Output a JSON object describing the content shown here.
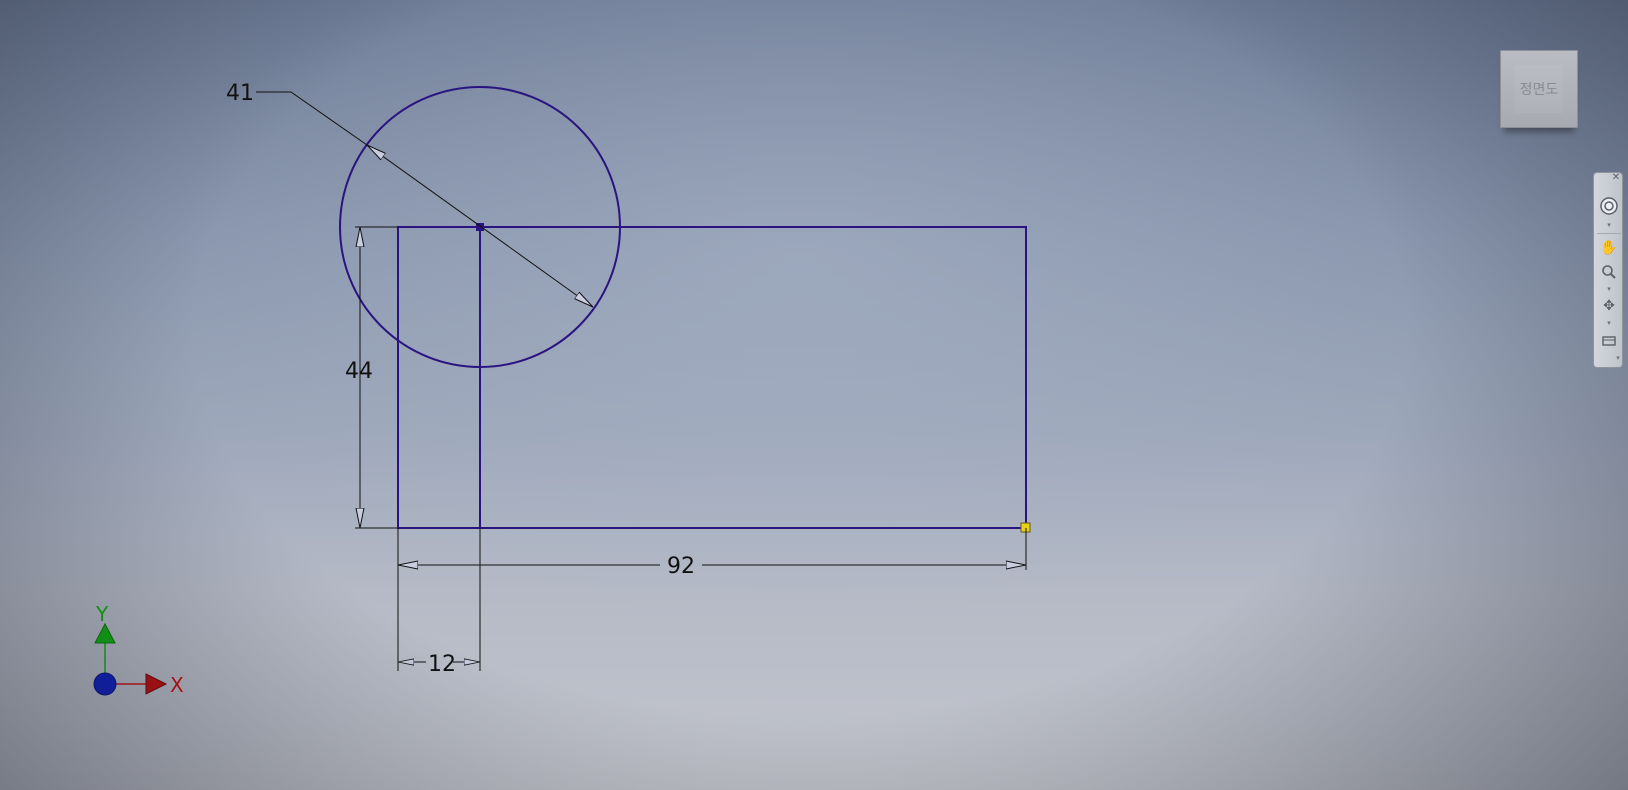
{
  "viewcube": {
    "face_label": "정면도"
  },
  "sketch": {
    "dimensions": {
      "diameter": "41",
      "height": "44",
      "width": "92",
      "offset": "12"
    },
    "colors": {
      "geometry": "#2a1480",
      "dimension": "#111111",
      "endpoint": "#e8d21a"
    }
  },
  "axes": {
    "x_label": "X",
    "y_label": "Y",
    "x_color": "#d01010",
    "y_color": "#10b010",
    "origin_color": "#1020c0"
  },
  "navbar": {
    "items": [
      {
        "icon": "close-icon"
      },
      {
        "icon": "steering-wheel-icon"
      },
      {
        "icon": "pan-icon"
      },
      {
        "icon": "zoom-icon"
      },
      {
        "icon": "orbit-icon"
      },
      {
        "icon": "look-at-icon"
      },
      {
        "icon": "customize-icon"
      }
    ]
  }
}
